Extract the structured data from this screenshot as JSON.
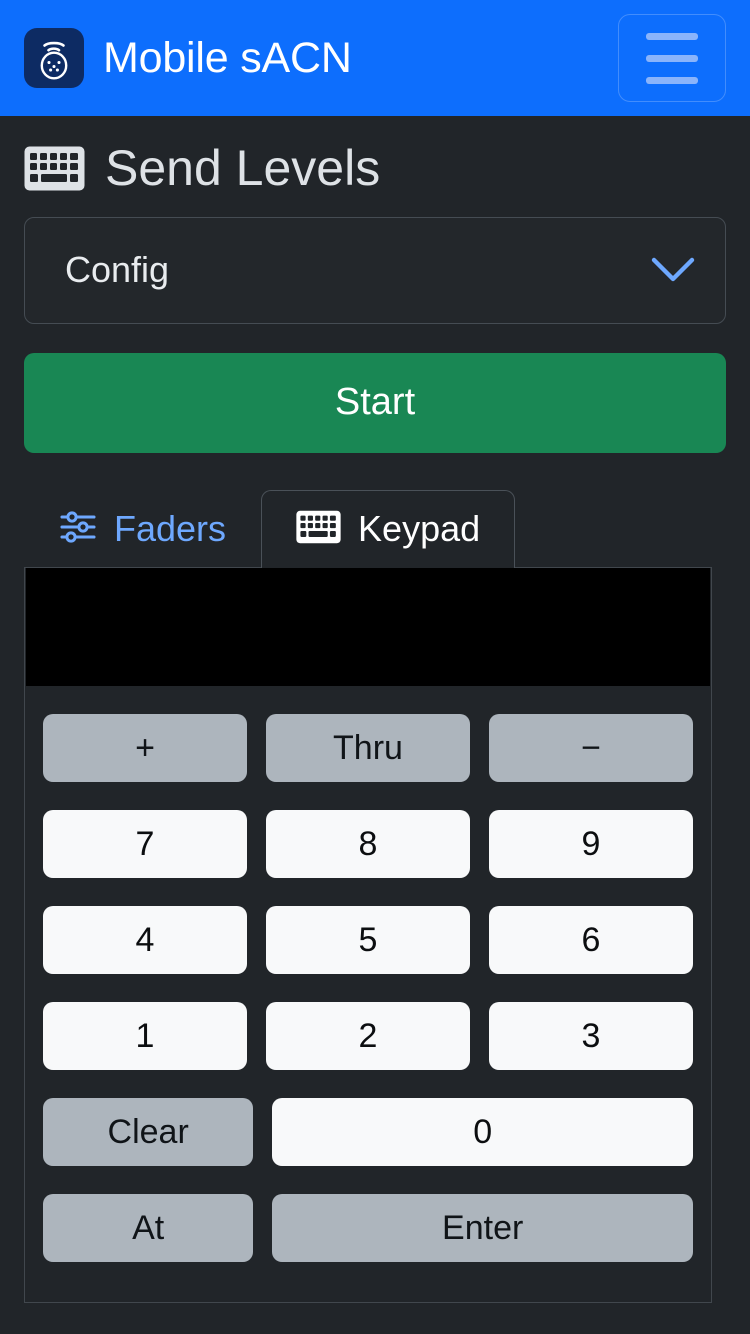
{
  "navbar": {
    "brand_title": "Mobile sACN",
    "logo_icon": "sacn-node-icon",
    "toggler_icon": "hamburger-menu-icon",
    "background_color": "#0d6efd"
  },
  "page": {
    "title": "Send Levels",
    "title_icon": "keyboard-icon"
  },
  "config_accordion": {
    "label": "Config",
    "chevron_icon": "chevron-down-icon",
    "expanded": "false"
  },
  "start_button": {
    "label": "Start",
    "color": "#198754"
  },
  "tabs": [
    {
      "label": "Faders",
      "icon": "sliders-icon",
      "active": "false",
      "color": "#6ea8fe"
    },
    {
      "label": "Keypad",
      "icon": "keyboard-icon",
      "active": "true",
      "color": "#ffffff"
    }
  ],
  "keypad": {
    "display_value": "",
    "display_background": "#000000",
    "rows": [
      [
        {
          "label": "+",
          "style": "secondary",
          "span": 1,
          "name": "key-plus"
        },
        {
          "label": "Thru",
          "style": "secondary",
          "span": 1,
          "name": "key-thru"
        },
        {
          "label": "−",
          "style": "secondary",
          "span": 1,
          "name": "key-minus"
        }
      ],
      [
        {
          "label": "7",
          "style": "light",
          "span": 1,
          "name": "key-7"
        },
        {
          "label": "8",
          "style": "light",
          "span": 1,
          "name": "key-8"
        },
        {
          "label": "9",
          "style": "light",
          "span": 1,
          "name": "key-9"
        }
      ],
      [
        {
          "label": "4",
          "style": "light",
          "span": 1,
          "name": "key-4"
        },
        {
          "label": "5",
          "style": "light",
          "span": 1,
          "name": "key-5"
        },
        {
          "label": "6",
          "style": "light",
          "span": 1,
          "name": "key-6"
        }
      ],
      [
        {
          "label": "1",
          "style": "light",
          "span": 1,
          "name": "key-1"
        },
        {
          "label": "2",
          "style": "light",
          "span": 1,
          "name": "key-2"
        },
        {
          "label": "3",
          "style": "light",
          "span": 1,
          "name": "key-3"
        }
      ],
      [
        {
          "label": "Clear",
          "style": "secondary",
          "span": 1,
          "name": "key-clear"
        },
        {
          "label": "0",
          "style": "light",
          "span": 2,
          "name": "key-0"
        }
      ],
      [
        {
          "label": "At",
          "style": "secondary",
          "span": 1,
          "name": "key-at"
        },
        {
          "label": "Enter",
          "style": "secondary",
          "span": 2,
          "name": "key-enter"
        }
      ]
    ]
  },
  "colors": {
    "body_background": "#212529",
    "brand_blue": "#0d6efd",
    "success_green": "#198754",
    "secondary_gray": "#adb5bd",
    "light_key": "#f8f9fa",
    "link_blue": "#6ea8fe"
  }
}
